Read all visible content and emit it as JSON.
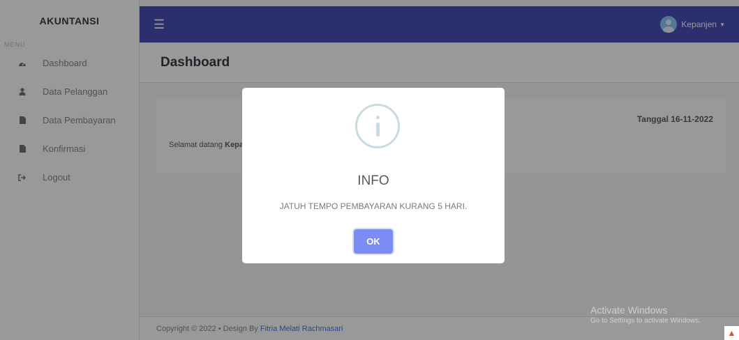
{
  "sidebar": {
    "brand": "AKUNTANSI",
    "menu_heading": "MENU",
    "items": [
      {
        "label": "Dashboard",
        "icon": "tachometer-icon"
      },
      {
        "label": "Data Pelanggan",
        "icon": "user-icon"
      },
      {
        "label": "Data Pembayaran",
        "icon": "file-icon"
      },
      {
        "label": "Konfirmasi",
        "icon": "file-icon"
      },
      {
        "label": "Logout",
        "icon": "sign-out-icon"
      }
    ]
  },
  "topbar": {
    "user_name": "Kepanjen"
  },
  "content": {
    "page_title": "Dashboard",
    "date_label": "Tanggal 16-11-2022",
    "welcome_prefix": "Selamat datang ",
    "welcome_name": "Kepa"
  },
  "footer": {
    "copyright": "Copyright © 2022  •  Design By",
    "designer": "Fitria Melati Rachmasari"
  },
  "modal": {
    "title": "INFO",
    "message": "JATUH TEMPO PEMBAYARAN KURANG 5 HARI.",
    "ok_label": "OK"
  },
  "watermark": {
    "line1": "Activate Windows",
    "line2": "Go to Settings to activate Windows."
  },
  "colors": {
    "topbar": "#4a4fb6",
    "ok_button": "#7d8cf4",
    "info_icon": "#c9dae1"
  }
}
